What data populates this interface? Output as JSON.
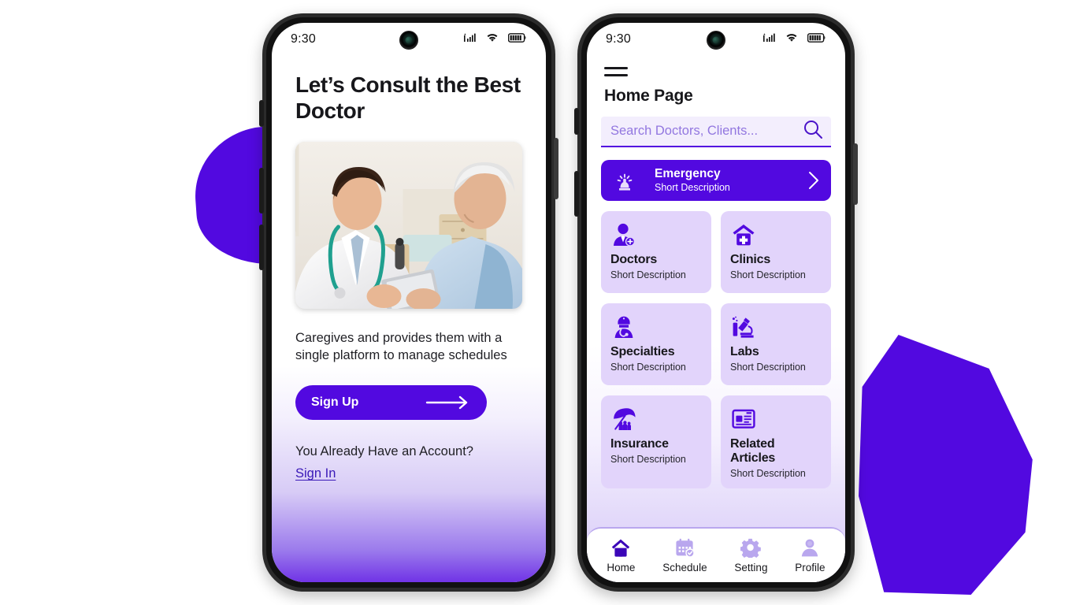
{
  "colors": {
    "primary": "#5209e0",
    "card_bg": "#e2d4fb",
    "search_bg": "#f3eefd",
    "tab_inactive": "#b9a7ee",
    "link": "#3a19b8"
  },
  "phone_one": {
    "status": {
      "time": "9:30",
      "signal_icon": "signal-bars-icon",
      "wifi_icon": "wifi-icon",
      "battery_icon": "battery-icon",
      "camera_icon": "front-camera-icon"
    },
    "title": "Let’s Consult the Best Doctor",
    "photo_alt": "doctor-consulting-elderly-patient-photo",
    "description": "Caregives and provides them with a single platform to manage schedules",
    "cta_label": "Sign Up",
    "cta_arrow_icon": "arrow-right-icon",
    "account_prompt": "You Already Have an Account?",
    "signin_label": "Sign In"
  },
  "phone_two": {
    "status": {
      "time": "9:30",
      "signal_icon": "signal-bars-icon",
      "wifi_icon": "wifi-icon",
      "battery_icon": "battery-icon",
      "camera_icon": "front-camera-icon"
    },
    "menu_icon": "hamburger-menu-icon",
    "page_title": "Home Page",
    "search": {
      "placeholder": "Search Doctors, Clients...",
      "value": "",
      "icon": "search-icon"
    },
    "emergency": {
      "title": "Emergency",
      "subtitle": "Short Description",
      "icon": "siren-alarm-icon",
      "chevron_icon": "chevron-right-icon"
    },
    "cards": [
      {
        "title": "Doctors",
        "subtitle": "Short Description",
        "icon": "doctor-icon"
      },
      {
        "title": "Clinics",
        "subtitle": "Short Description",
        "icon": "clinic-building-icon"
      },
      {
        "title": "Specialties",
        "subtitle": "Short Description",
        "icon": "surgeon-icon"
      },
      {
        "title": "Labs",
        "subtitle": "Short Description",
        "icon": "microscope-icon"
      },
      {
        "title": "Insurance",
        "subtitle": "Short Description",
        "icon": "umbrella-family-icon"
      },
      {
        "title": "Related Articles",
        "subtitle": "Short Description",
        "icon": "news-article-icon"
      }
    ],
    "tabs": [
      {
        "label": "Home",
        "icon": "home-icon",
        "active": true
      },
      {
        "label": "Schedule",
        "icon": "calendar-icon",
        "active": false
      },
      {
        "label": "Setting",
        "icon": "gear-icon",
        "active": false
      },
      {
        "label": "Profile",
        "icon": "person-icon",
        "active": false
      }
    ]
  }
}
